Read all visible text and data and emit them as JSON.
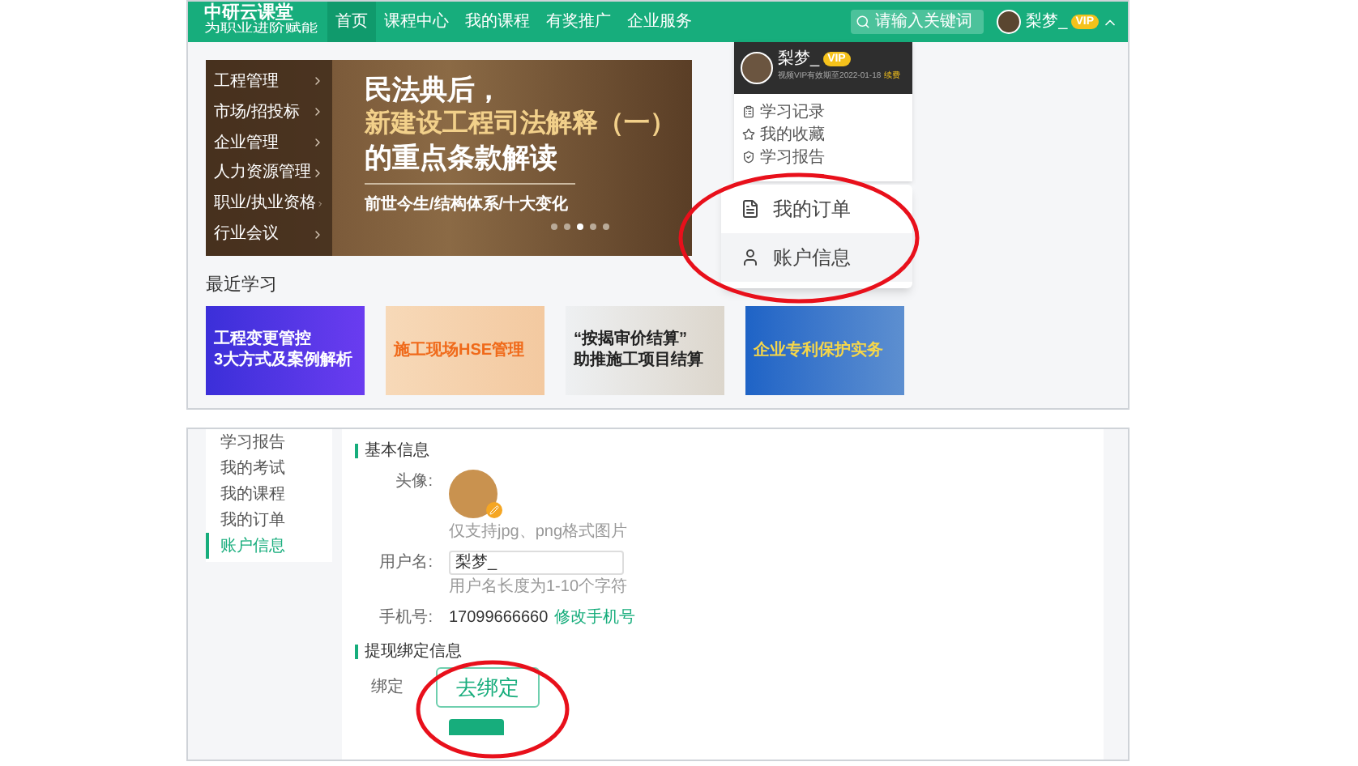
{
  "nav": {
    "logo_title": "中研云课堂",
    "logo_subtitle": "为职业进阶赋能",
    "items": [
      {
        "label": "首页",
        "selected": true
      },
      {
        "label": "课程中心",
        "selected": false
      },
      {
        "label": "我的课程",
        "selected": false
      },
      {
        "label": "有奖推广",
        "selected": false
      },
      {
        "label": "企业服务",
        "selected": false
      }
    ],
    "search": {
      "placeholder": "请输入关键词"
    },
    "user": {
      "name": "梨梦_",
      "badge": "VIP",
      "expanded": true
    }
  },
  "banner": {
    "categories": [
      "工程管理",
      "市场/招投标",
      "企业管理",
      "人力资源管理",
      "职业/执业资格",
      "行业会议"
    ],
    "headline": "民法典后，",
    "headline_highlight": "新建设工程司法解释（一）",
    "headline_end": "的重点条款解读",
    "subline": "前世今生/结构体系/十大变化",
    "dots": [
      {
        "selected": false
      },
      {
        "selected": false
      },
      {
        "selected": true
      },
      {
        "selected": false
      },
      {
        "selected": false
      }
    ]
  },
  "account_menu": {
    "name": "梨梦_",
    "badge": "VIP",
    "expiry": "视频VIP有效期至2022-01-18",
    "renew": "续费",
    "items": [
      {
        "label": "学习记录",
        "kind": "record"
      },
      {
        "label": "我的收藏",
        "kind": "star"
      },
      {
        "label": "学习报告",
        "kind": "report"
      }
    ],
    "callout_items": [
      {
        "label": "我的订单",
        "kind": "order"
      },
      {
        "label": "账户信息",
        "kind": "user"
      }
    ]
  },
  "recent": {
    "title": "最近学习",
    "cards": [
      {
        "kind": "purple",
        "lines": [
          "工程变更管控",
          "3大方式及案例解析"
        ]
      },
      {
        "kind": "peach",
        "lines": [
          "施工现场HSE管理"
        ]
      },
      {
        "kind": "paper",
        "lines": [
          "“按揭审价结算”",
          "助推施工项目结算"
        ]
      },
      {
        "kind": "blue",
        "lines": [
          "企业专利保护实务"
        ]
      }
    ]
  },
  "settings": {
    "sidebar": [
      {
        "label": "学习报告",
        "selected": false
      },
      {
        "label": "我的考试",
        "selected": false
      },
      {
        "label": "我的课程",
        "selected": false
      },
      {
        "label": "我的订单",
        "selected": false
      },
      {
        "label": "账户信息",
        "selected": true
      }
    ],
    "basic_title": "基本信息",
    "avatar_label": "头像:",
    "avatar_hint": "仅支持jpg、png格式图片",
    "username_label": "用户名:",
    "username_value": "梨梦_",
    "username_hint": "用户名长度为1-10个字符",
    "phone_label": "手机号:",
    "phone_value": "17099666660",
    "phone_link": "修改手机号",
    "bind_title": "提现绑定信息",
    "bind_label": "绑定",
    "bind_button": "去绑定"
  }
}
